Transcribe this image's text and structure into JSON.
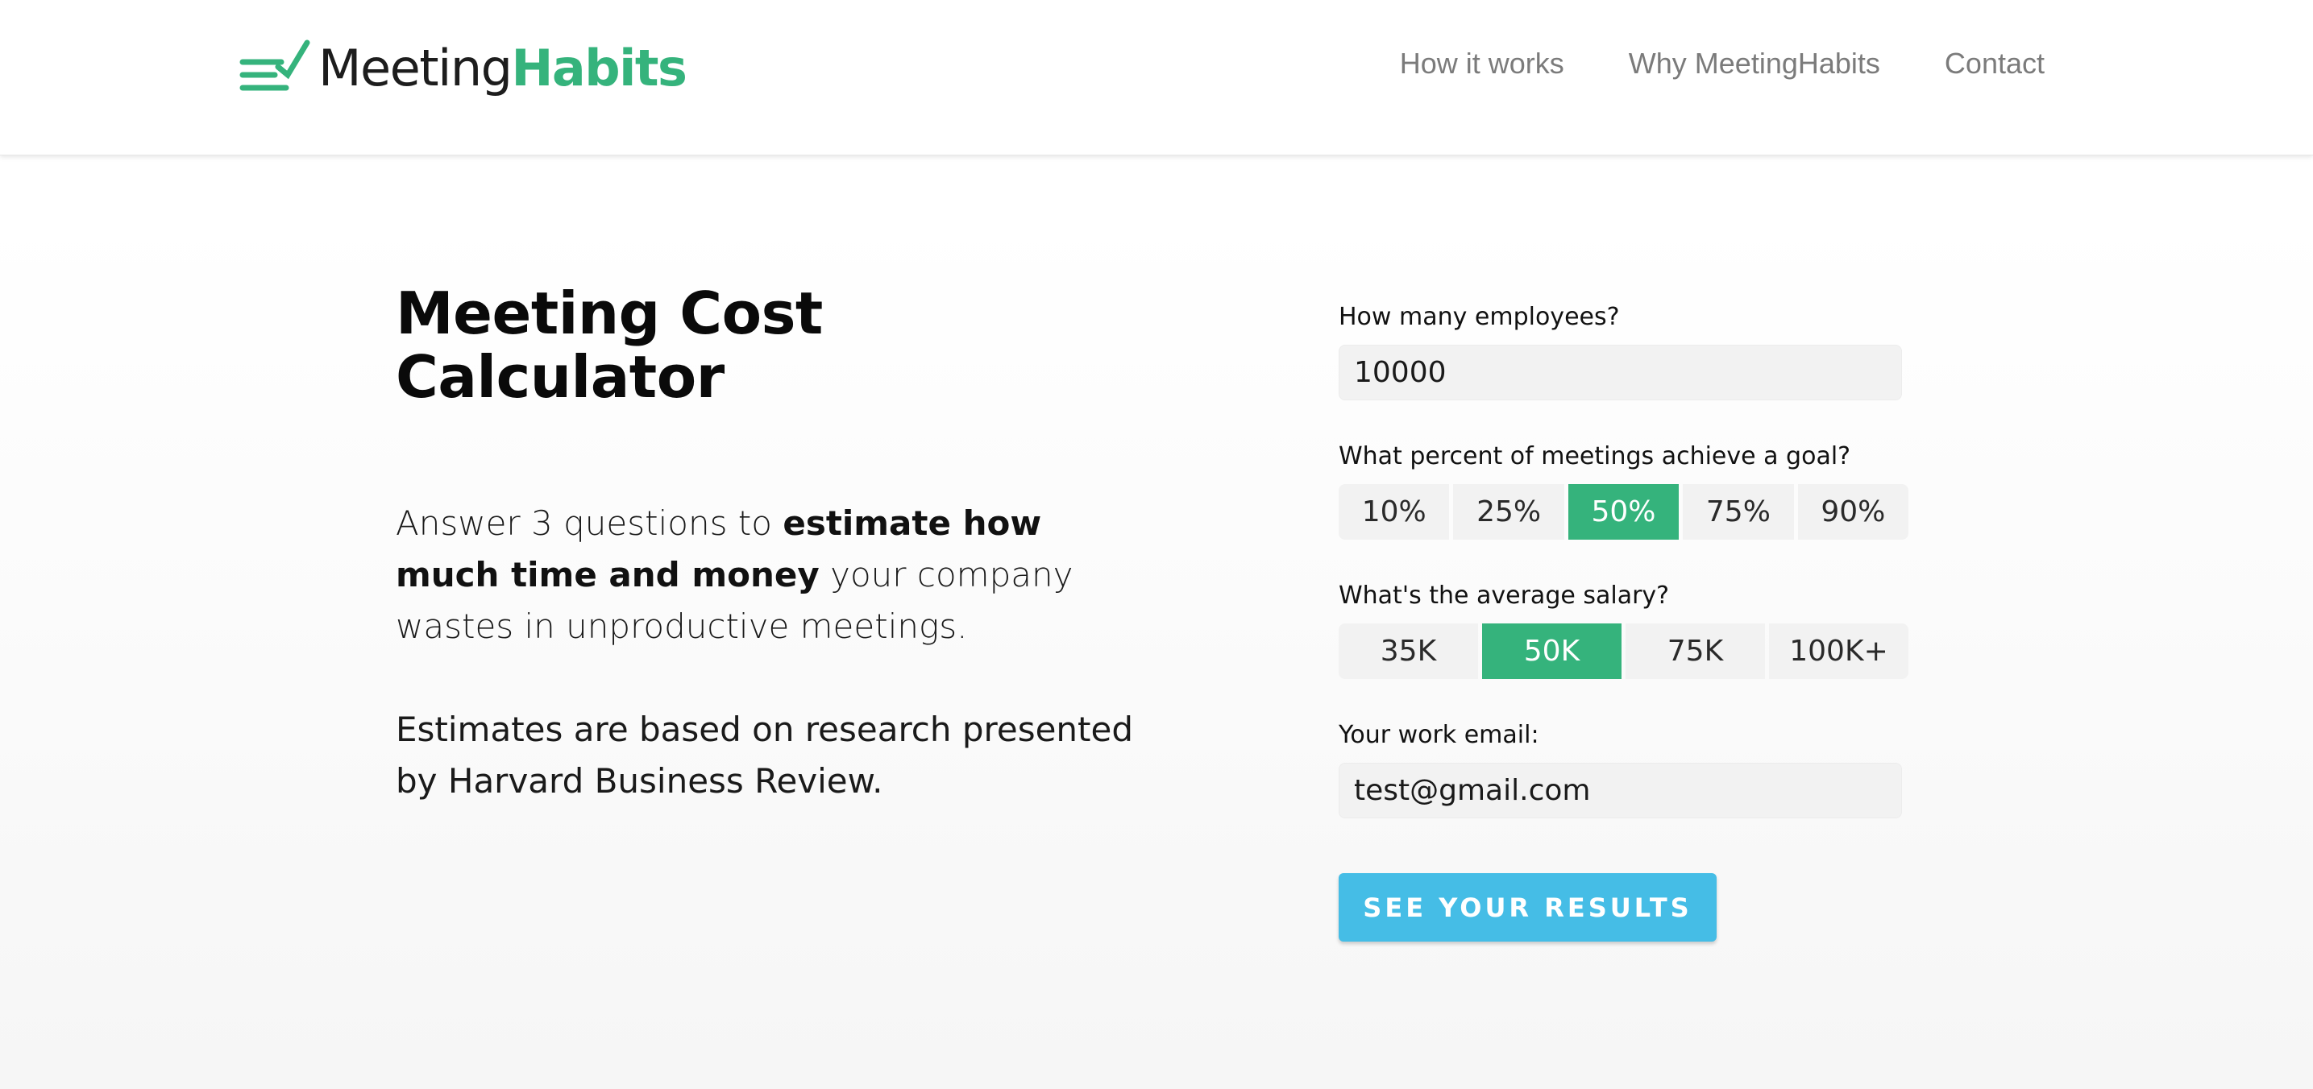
{
  "brand": {
    "name_part1": "Meeting",
    "name_part2": "Habits",
    "accent_color": "#35b37c",
    "logo_icon": "checklist-icon"
  },
  "nav": {
    "items": [
      {
        "label": "How it works"
      },
      {
        "label": "Why MeetingHabits"
      },
      {
        "label": "Contact"
      }
    ]
  },
  "intro": {
    "title": "Meeting Cost Calculator",
    "text_before": "Answer 3 questions to ",
    "text_bold": "estimate how much time and money",
    "text_after": " your company wastes in unproductive meetings.",
    "source_note": "Estimates are based on research presented by Harvard Business Review."
  },
  "form": {
    "employees": {
      "label": "How many employees?",
      "value": "10000"
    },
    "goal_percent": {
      "label": "What percent of meetings achieve a goal?",
      "options": [
        "10%",
        "25%",
        "50%",
        "75%",
        "90%"
      ],
      "selected": "50%"
    },
    "salary": {
      "label": "What's the average salary?",
      "options": [
        "35K",
        "50K",
        "75K",
        "100K+"
      ],
      "selected": "50K"
    },
    "email": {
      "label": "Your work email:",
      "value": "test@gmail.com"
    },
    "submit_label": "SEE YOUR RESULTS",
    "submit_color": "#45bde6",
    "selected_color": "#35b37c"
  }
}
